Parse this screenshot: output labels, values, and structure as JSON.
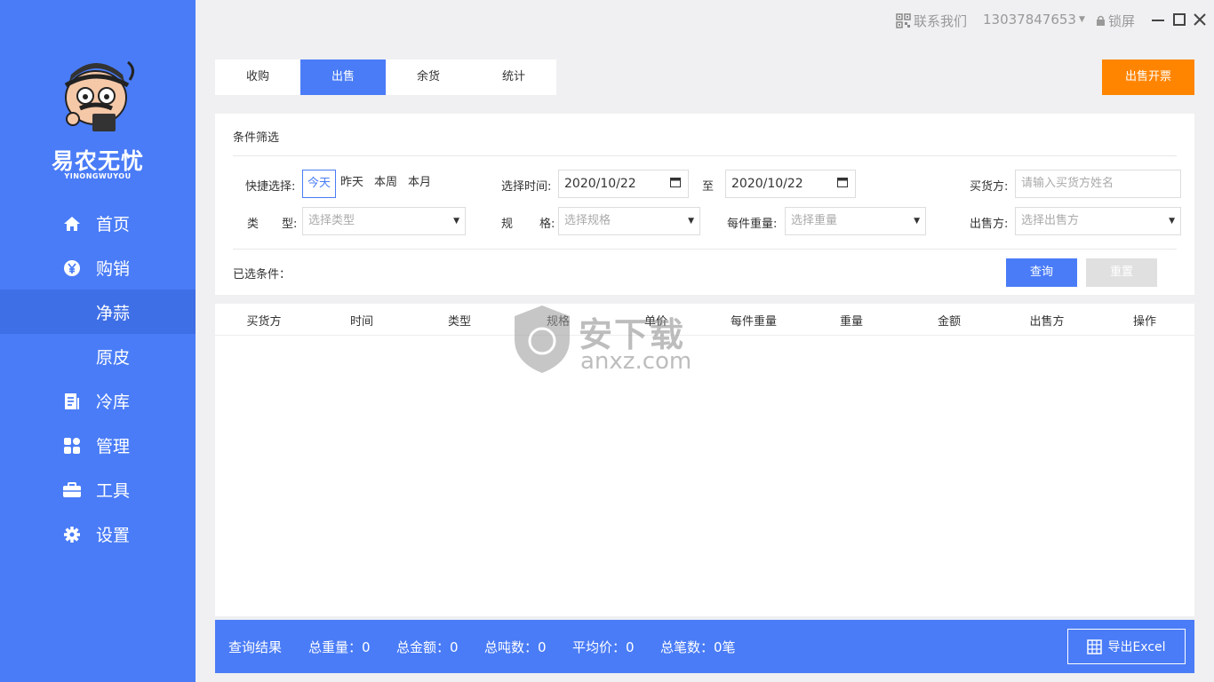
{
  "brand": {
    "name": "易农无忧",
    "sub": "YINONGWUYOU"
  },
  "sidebar": {
    "items": [
      {
        "label": "首页",
        "icon": "home-icon"
      },
      {
        "label": "购销",
        "icon": "yen-icon"
      },
      {
        "label": "净蒜",
        "icon": ""
      },
      {
        "label": "原皮",
        "icon": ""
      },
      {
        "label": "冷库",
        "icon": "document-icon"
      },
      {
        "label": "管理",
        "icon": "grid-icon"
      },
      {
        "label": "工具",
        "icon": "briefcase-icon"
      },
      {
        "label": "设置",
        "icon": "gear-icon"
      }
    ],
    "active_index": 2
  },
  "titlebar": {
    "contact": "联系我们",
    "phone": "13037847653",
    "lock": "锁屏"
  },
  "tabs": [
    {
      "label": "收购"
    },
    {
      "label": "出售"
    },
    {
      "label": "余货"
    },
    {
      "label": "统计"
    }
  ],
  "active_tab": 1,
  "sell_invoice_label": "出售开票",
  "filter": {
    "title": "条件筛选",
    "quick_label": "快捷选择:",
    "quick_options": [
      "今天",
      "昨天",
      "本周",
      "本月"
    ],
    "time_label": "选择时间:",
    "date_from": "2020/10/22",
    "to_label": "至",
    "date_to": "2020/10/22",
    "buyer_label": "买货方:",
    "buyer_placeholder": "请输入买货方姓名",
    "type_label_a": "类",
    "type_label_b": "型:",
    "type_placeholder": "选择类型",
    "spec_label_a": "规",
    "spec_label_b": "格:",
    "spec_placeholder": "选择规格",
    "weight_label": "每件重量:",
    "weight_placeholder": "选择重量",
    "seller_label": "出售方:",
    "seller_placeholder": "选择出售方",
    "selected_label": "已选条件：",
    "query_label": "查询",
    "reset_label": "重置"
  },
  "table": {
    "columns": [
      "买货方",
      "时间",
      "类型",
      "规格",
      "单价",
      "每件重量",
      "重量",
      "金额",
      "出售方",
      "操作"
    ]
  },
  "watermark": {
    "cn": "安下载",
    "en": "anxz.com"
  },
  "summary": {
    "title": "查询结果",
    "total_weight": "总重量：0",
    "total_amount": "总金额：0",
    "total_tons": "总吨数：0",
    "avg_price": "平均价：0",
    "total_count": "总笔数：0笔",
    "export_label": "导出Excel"
  },
  "colors": {
    "primary": "#4a7cf7",
    "accent": "#ff8500"
  }
}
